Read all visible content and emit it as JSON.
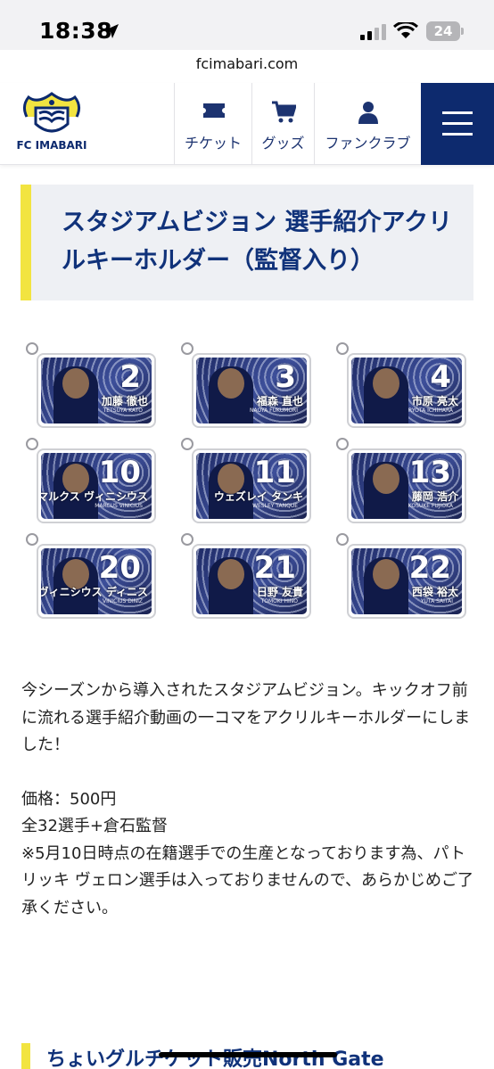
{
  "status_bar": {
    "time": "18:38",
    "battery": "24"
  },
  "browser": {
    "url": "fcimabari.com"
  },
  "header": {
    "logo_text": "FC IMABARI",
    "buttons": [
      {
        "label": "チケット",
        "icon": "ticket-icon"
      },
      {
        "label": "グッズ",
        "icon": "cart-icon"
      },
      {
        "label": "ファンクラブ",
        "icon": "person-icon"
      }
    ],
    "menu_icon": "hamburger-icon"
  },
  "article": {
    "title": "スタジアムビジョン 選手紹介アクリルキーホルダー（監督入り）",
    "keyholders": [
      {
        "number": "2",
        "name": "加藤 徹也",
        "name_en": "TETSUYA KATO"
      },
      {
        "number": "3",
        "name": "福森 直也",
        "name_en": "NAOYA FUKUMORI"
      },
      {
        "number": "4",
        "name": "市原 亮太",
        "name_en": "RYOTA ICHIHARA"
      },
      {
        "number": "10",
        "name": "マルクス ヴィニシウス",
        "name_en": "MARCUS VINICIUS"
      },
      {
        "number": "11",
        "name": "ウェズレイ タンキ",
        "name_en": "WESLEY TANQUE"
      },
      {
        "number": "13",
        "name": "藤岡 浩介",
        "name_en": "KOSUKE FUJIOKA"
      },
      {
        "number": "20",
        "name": "ヴィニシウス ディニス",
        "name_en": "VINICIUS DINIZ"
      },
      {
        "number": "21",
        "name": "日野 友貴",
        "name_en": "TOMOKI HINO"
      },
      {
        "number": "22",
        "name": "西袋 裕太",
        "name_en": "YUTA SAITAI"
      }
    ],
    "paragraph1": "今シーズンから導入されたスタジアムビジョン。キックオフ前に流れる選手紹介動画の一コマをアクリルキーホルダーにしました！",
    "price": "価格：500円",
    "lineup": "全32選手+倉石監督",
    "note": "※5月10日時点の在籍選手での生産となっております為、パトリッキ ヴェロン選手は入っておりませんので、あらかじめご了承ください。"
  },
  "next_section": {
    "title": "ちょいグルチケット販売North Gate"
  }
}
